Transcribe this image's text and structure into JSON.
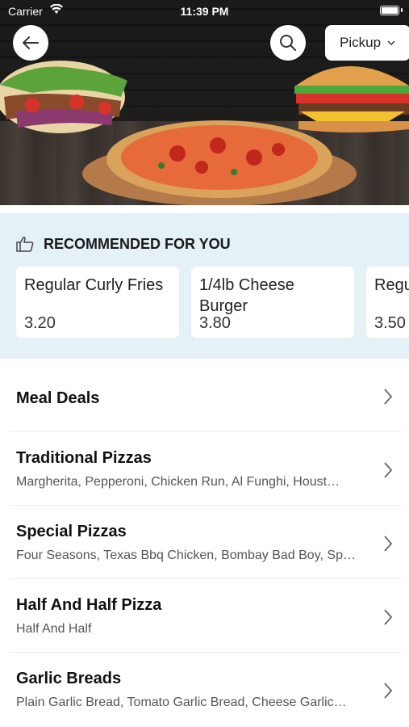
{
  "status_bar": {
    "carrier": "Carrier",
    "time": "11:39 PM"
  },
  "header": {
    "pickup_label": "Pickup"
  },
  "recommended": {
    "title": "RECOMMENDED FOR YOU",
    "items": [
      {
        "name": "Regular Curly Fries",
        "price": "3.20"
      },
      {
        "name": "1/4lb Cheese Burger",
        "price": "3.80"
      },
      {
        "name": "Regular Cheese",
        "price": "3.50"
      }
    ]
  },
  "categories": [
    {
      "title": "Meal Deals",
      "subtitle": ""
    },
    {
      "title": "Traditional Pizzas",
      "subtitle": "Margherita, Pepperoni, Chicken Run, Al Funghi, Houst…"
    },
    {
      "title": "Special Pizzas",
      "subtitle": "Four Seasons, Texas Bbq Chicken, Bombay Bad Boy, Sp…"
    },
    {
      "title": "Half And Half Pizza",
      "subtitle": "Half And Half"
    },
    {
      "title": "Garlic Breads",
      "subtitle": "Plain Garlic Bread, Tomato Garlic Bread, Cheese Garlic…"
    }
  ],
  "colors": {
    "recommended_bg": "#e4f1f6",
    "text": "#111111"
  }
}
